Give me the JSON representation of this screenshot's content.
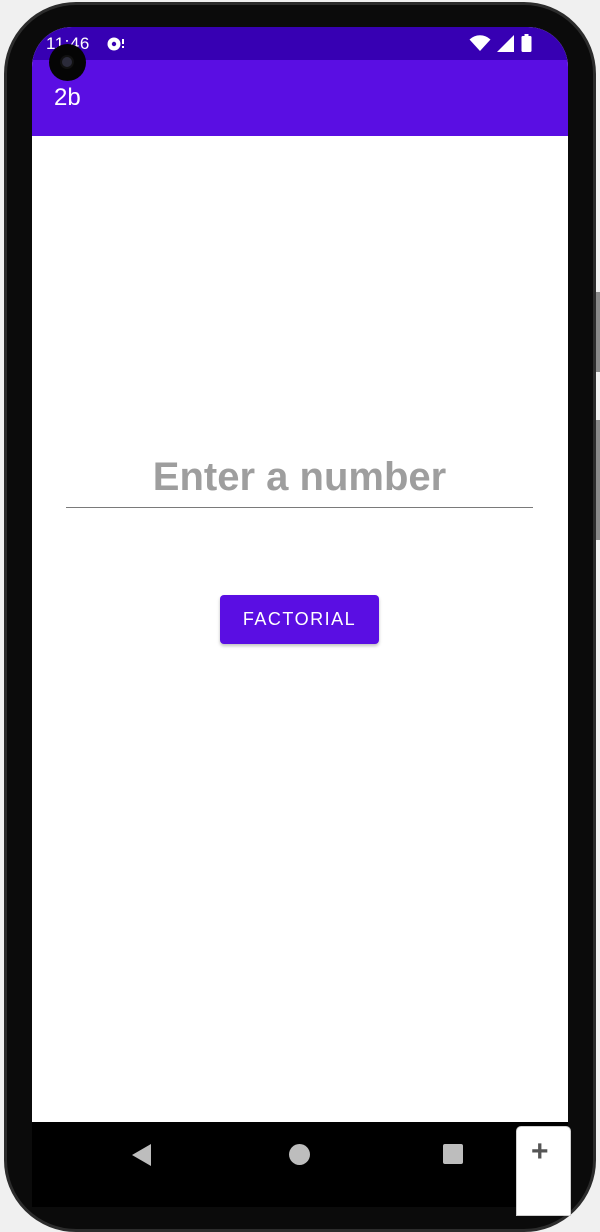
{
  "status_bar": {
    "time": "11:46",
    "icons": [
      "app-notification-icon",
      "wifi-icon",
      "signal-icon",
      "battery-icon"
    ]
  },
  "app_bar": {
    "title": "2b"
  },
  "form": {
    "number_input": {
      "value": "",
      "placeholder": "Enter a number"
    },
    "factorial_button_label": "FACTORIAL"
  },
  "nav_bar": {
    "icons": [
      "back-icon",
      "home-icon",
      "recents-icon"
    ]
  },
  "emulator": {
    "add_tab_icon": "plus-icon",
    "add_tab_label": "+"
  },
  "colors": {
    "status_bar": "#3700b3",
    "app_bar": "#5a0ee3",
    "button": "#5a0ee3",
    "placeholder": "#9e9e9e"
  }
}
